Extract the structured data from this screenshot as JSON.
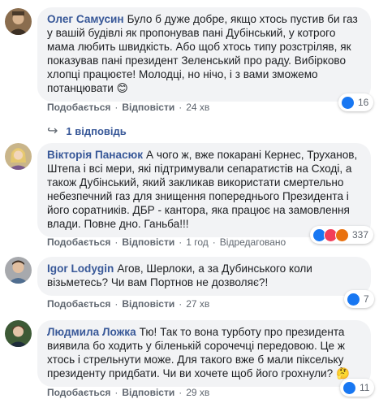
{
  "comments": [
    {
      "author": "Олег Самусин",
      "text": "Було б дуже добре, якщо хтось пустив би газ у вашій будівлі як пропонував пані Дубінський, у котрого мама любить швидкість. Або щоб хтось типу розстріляв, як показував пані президент Зеленський про раду. Вибірково хлопці працюєте! Молодці, но нічо, і з вами зможемо потанцювати 😊",
      "like_label": "Подобається",
      "reply_label": "Відповісти",
      "time": "24 хв",
      "reaction_count": "16"
    },
    {
      "author": "Вікторія Панасюк",
      "text": "А чого ж, вже покарані Кернес, Труханов, Штепа і всі мери, які підтримували сепаратистів на Сході, а також Дубінський, який закликав використати смертельно небезпечний газ для знищення попереднього Президента і його соратників. ДБР - кантора, яка працює на замовлення влади. Повне дно. Ганьба!!!",
      "like_label": "Подобається",
      "reply_label": "Відповісти",
      "time": "1 год",
      "edited": "Відредаговано",
      "reaction_count": "337"
    },
    {
      "author": "Igor Lodygin",
      "text": "Агов, Шерлоки, а за Дубинського коли візьметесь? Чи вам Портнов не дозволяє?!",
      "like_label": "Подобається",
      "reply_label": "Відповісти",
      "time": "27 хв",
      "reaction_count": "7"
    },
    {
      "author": "Людмила Ложка",
      "text": "Тю! Так то вона турботу про президента виявила бо ходить у біленькій сорочечці передовою. Це ж хтось і стрельнути може. Для такого вже б мали піксельку президенту придбати. Чи ви хочете щоб його грохнули? 🤔",
      "like_label": "Подобається",
      "reply_label": "Відповісти",
      "time": "29 хв",
      "reaction_count": "11"
    }
  ],
  "replies_link": "1 відповідь",
  "colors": {
    "name": "#385898",
    "bubble": "#f2f3f5",
    "meta": "#606770",
    "like_blue": "#1877f2"
  },
  "icons": [
    "like-icon",
    "love-icon",
    "angry-icon",
    "reply-arrow-icon"
  ]
}
